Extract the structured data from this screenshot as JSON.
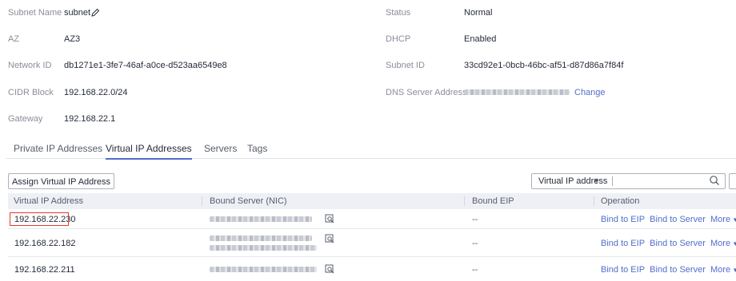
{
  "details": {
    "subnet_name_label": "Subnet Name",
    "subnet_name_value": "subnet",
    "az_label": "AZ",
    "az_value": "AZ3",
    "network_id_label": "Network ID",
    "network_id_value": "db1271e1-3fe7-46af-a0ce-d523aa6549e8",
    "cidr_label": "CIDR Block",
    "cidr_value": "192.168.22.0/24",
    "gateway_label": "Gateway",
    "gateway_value": "192.168.22.1",
    "status_label": "Status",
    "status_value": "Normal",
    "dhcp_label": "DHCP",
    "dhcp_value": "Enabled",
    "subnet_id_label": "Subnet ID",
    "subnet_id_value": "33cd92e1-0bcb-46bc-af51-d87d86a7f84f",
    "dns_label": "DNS Server Address",
    "dns_change": "Change"
  },
  "tabs": [
    "Private IP Addresses",
    "Virtual IP Addresses",
    "Servers",
    "Tags"
  ],
  "active_tab": "Virtual IP Addresses",
  "toolbar": {
    "assign_button": "Assign Virtual IP Address",
    "search_filter": "Virtual IP address",
    "search_placeholder": ""
  },
  "table": {
    "columns": [
      "Virtual IP Address",
      "Bound Server (NIC)",
      "Bound EIP",
      "Operation"
    ],
    "rows": [
      {
        "ip": "192.168.22.230",
        "eip": "--",
        "op1": "Bind to EIP",
        "op2": "Bind to Server",
        "op3": "More"
      },
      {
        "ip": "192.168.22.182",
        "eip": "--",
        "op1": "Bind to EIP",
        "op2": "Bind to Server",
        "op3": "More"
      },
      {
        "ip": "192.168.22.211",
        "eip": "--",
        "op1": "Bind to EIP",
        "op2": "Bind to Server",
        "op3": "More"
      }
    ]
  },
  "colors": {
    "link": "#526ecc",
    "highlight_box": "#e03c32",
    "tab_underline": "#526ecc"
  }
}
